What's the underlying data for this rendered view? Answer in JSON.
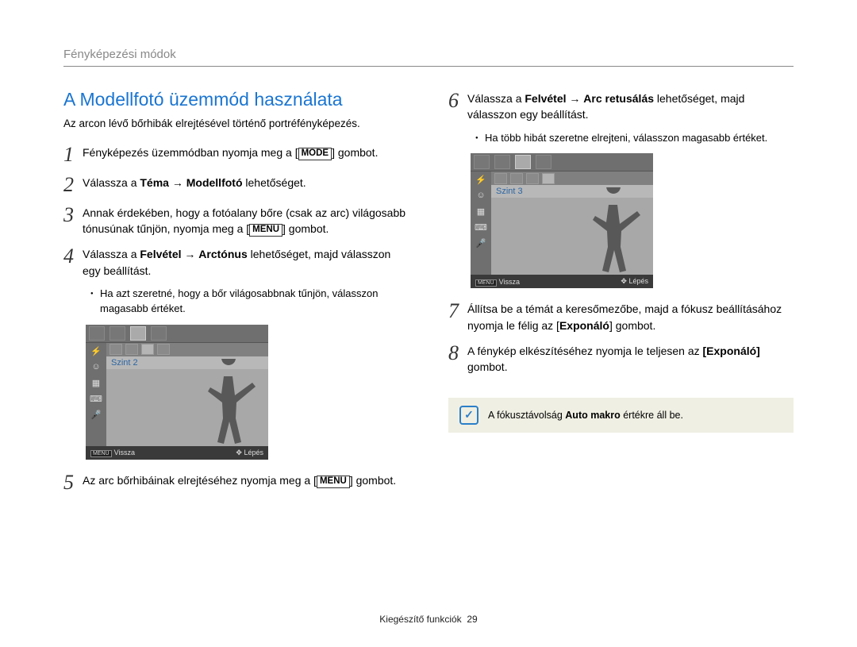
{
  "header": "Fényképezési módok",
  "title": "A Modellfotó üzemmód használata",
  "intro": "Az arcon lévő bőrhibák elrejtésével történő portréfényképezés.",
  "left_steps": {
    "s1_pre": "Fényképezés üzemmódban nyomja meg a ",
    "s1_btn": "MODE",
    "s1_post": " gombot.",
    "s2_pre": "Válassza a ",
    "s2_b1": "Téma",
    "s2_arrow": " → ",
    "s2_b2": "Modellfotó",
    "s2_post": " lehetőséget.",
    "s3_pre": "Annak érdekében, hogy a fotóalany bőre (csak az arc) világosabb tónusúnak tűnjön, nyomja meg a ",
    "s3_btn": "MENU",
    "s3_post": " gombot.",
    "s4_pre": "Válassza a ",
    "s4_b1": "Felvétel",
    "s4_arrow": " → ",
    "s4_b2": "Arctónus",
    "s4_post": " lehetőséget, majd válasszon egy beállítást.",
    "s4_sub": "Ha azt szeretné, hogy a bőr világosabbnak tűnjön, válasszon magasabb értéket.",
    "s5_pre": "Az arc bőrhibáinak elrejtéséhez nyomja meg a ",
    "s5_btn": "MENU",
    "s5_post": " gombot."
  },
  "right_steps": {
    "s6_pre": "Válassza a ",
    "s6_b1": "Felvétel",
    "s6_arrow": " → ",
    "s6_b2": "Arc retusálás",
    "s6_post": " lehetőséget, majd válasszon egy beállítást.",
    "s6_sub": "Ha több hibát szeretne elrejteni, válasszon magasabb értéket.",
    "s7_pre": "Állítsa be a témát a keresőmezőbe, majd a fókusz beállításához nyomja le félig az [",
    "s7_b": "Exponáló",
    "s7_post": "] gombot.",
    "s8_pre": "A fénykép elkészítéséhez nyomja le teljesen az ",
    "s8_b": "[Exponáló]",
    "s8_post": " gombot."
  },
  "lcd_left": {
    "level": "Szint 2",
    "back": "Vissza",
    "step": "Lépés",
    "menu": "MENU"
  },
  "lcd_right": {
    "level": "Szint 3",
    "back": "Vissza",
    "step": "Lépés",
    "menu": "MENU"
  },
  "note_pre": "A fókusztávolság ",
  "note_b": "Auto makro",
  "note_post": " értékre áll be.",
  "footer_label": "Kiegészítő funkciók",
  "footer_page": "29"
}
